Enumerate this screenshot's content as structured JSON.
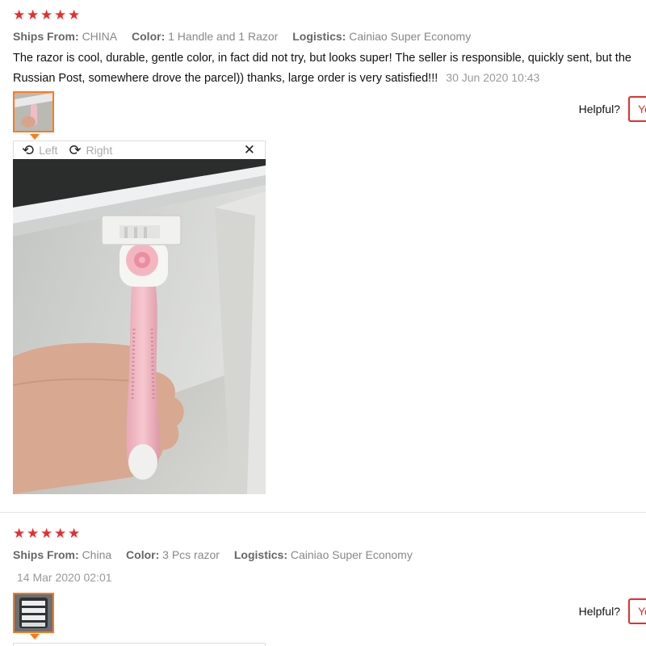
{
  "reviews": [
    {
      "stars": 5,
      "meta": [
        {
          "key": "Ships From:",
          "value": "CHINA"
        },
        {
          "key": "Color:",
          "value": "1 Handle and 1 Razor"
        },
        {
          "key": "Logistics:",
          "value": "Cainiao Super Economy"
        }
      ],
      "text": "The razor is cool, durable, gentle color, in fact did not try, but looks super! The seller is responsible, quickly sent, but the Russian Post, somewhere drove the parcel)) thanks, large order is very satisfied!!!",
      "date": "30 Jun 2020 10:43",
      "helpful_label": "Helpful?",
      "yes_label": "Yes"
    },
    {
      "stars": 5,
      "meta": [
        {
          "key": "Ships From:",
          "value": "China"
        },
        {
          "key": "Color:",
          "value": "3 Pcs razor"
        },
        {
          "key": "Logistics:",
          "value": "Cainiao Super Economy"
        }
      ],
      "date": "14 Mar 2020 02:01",
      "helpful_label": "Helpful?",
      "yes_label": "Yes"
    }
  ],
  "viewer": {
    "left_label": "Left",
    "right_label": "Right"
  },
  "icons": {
    "star": "star-icon",
    "rotate_left": "rotate-left-icon",
    "rotate_right": "rotate-right-icon",
    "close": "close-icon"
  },
  "colors": {
    "star": "#e62e2e",
    "accent_border": "#ff7a1a",
    "button_red": "#e62e2e"
  }
}
